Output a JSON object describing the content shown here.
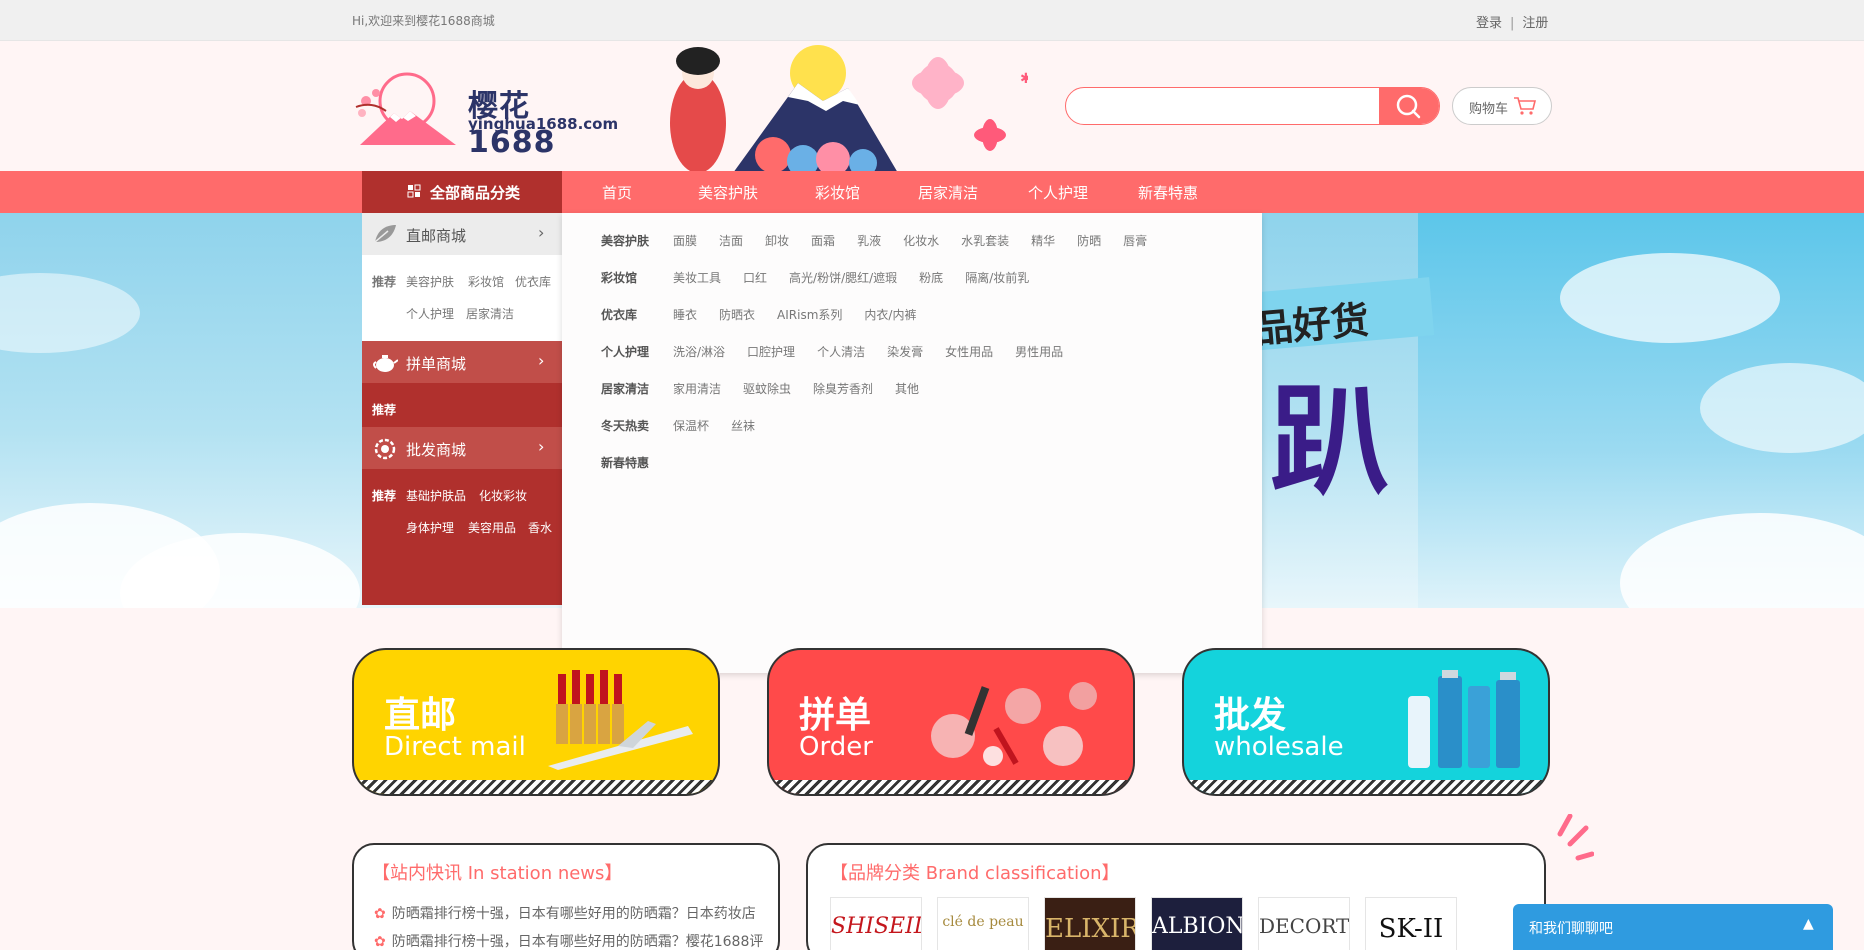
{
  "topbar": {
    "welcome": "Hi,欢迎来到樱花1688商城",
    "login": "登录",
    "separator": "|",
    "register": "注册"
  },
  "header": {
    "logo_name": "樱花1688",
    "logo_domain": "yinghua1688.com",
    "search_placeholder": "",
    "search_value": "",
    "cart_label": "购物车"
  },
  "nav": {
    "all_categories": "全部商品分类",
    "items": [
      "首页",
      "美容护肤",
      "彩妆馆",
      "居家清洁",
      "个人护理",
      "新春特惠"
    ]
  },
  "sidebar": {
    "direct": {
      "name": "直邮商城",
      "links": [
        "推荐",
        "美容护肤",
        "彩妆馆",
        "优衣库",
        "个人护理",
        "居家清洁"
      ]
    },
    "pindan": {
      "name": "拼单商城",
      "recommend": "推荐"
    },
    "pifa": {
      "name": "批发商城",
      "recommend": "推荐",
      "links": [
        "基础护肤品",
        "化妆彩妆",
        "身体护理",
        "美容用品",
        "香水"
      ]
    },
    "chevron": "›"
  },
  "dropdown": [
    {
      "category": "美容护肤",
      "items": [
        "面膜",
        "洁面",
        "卸妆",
        "面霜",
        "乳液",
        "化妆水",
        "水乳套装",
        "精华",
        "防晒",
        "唇膏"
      ]
    },
    {
      "category": "彩妆馆",
      "items": [
        "美妆工具",
        "口红",
        "高光/粉饼/腮红/遮瑕",
        "粉底",
        "隔离/妆前乳"
      ]
    },
    {
      "category": "优衣库",
      "items": [
        "睡衣",
        "防晒衣",
        "AIRism系列",
        "内衣/内裤"
      ]
    },
    {
      "category": "个人护理",
      "items": [
        "洗浴/淋浴",
        "口腔护理",
        "个人清洁",
        "染发膏",
        "女性用品",
        "男性用品"
      ]
    },
    {
      "category": "居家清洁",
      "items": [
        "家用清洁",
        "驱蚊除虫",
        "除臭芳香剂",
        "其他"
      ]
    },
    {
      "category": "冬天热卖",
      "items": [
        "保温杯",
        "丝袜"
      ]
    },
    {
      "category": "新春特惠",
      "items": []
    }
  ],
  "banner": {
    "tag_text": "品好货",
    "big_char": "趴"
  },
  "promos": {
    "direct": {
      "cn": "直邮",
      "en": "Direct mail"
    },
    "order": {
      "cn": "拼单",
      "en": "Order"
    },
    "wholesale": {
      "cn": "批发",
      "en": "wholesale"
    }
  },
  "news": {
    "title": "【站内快讯 In station news】",
    "bullet": "✿",
    "items": [
      "防晒霜排行榜十强，日本有哪些好用的防晒霜？日本药妆店",
      "防晒霜排行榜十强，日本有哪些好用的防晒霜？樱花1688评"
    ]
  },
  "brands": {
    "title": "【品牌分类 Brand classification】",
    "logos": [
      "SHISEIDO",
      "clé de peau",
      "ELIXIR",
      "ALBION",
      "DECORTÉ",
      "SK-II"
    ]
  },
  "chat": {
    "label": "和我们聊聊吧",
    "caret": "▲"
  },
  "colors": {
    "accent": "#ff6b6b",
    "dark_red": "#b0302d",
    "direct_yellow": "#ffd400",
    "order_red": "#ff4a4a",
    "wholesale_teal": "#14d3dc",
    "chat_blue": "#2f9be0"
  }
}
